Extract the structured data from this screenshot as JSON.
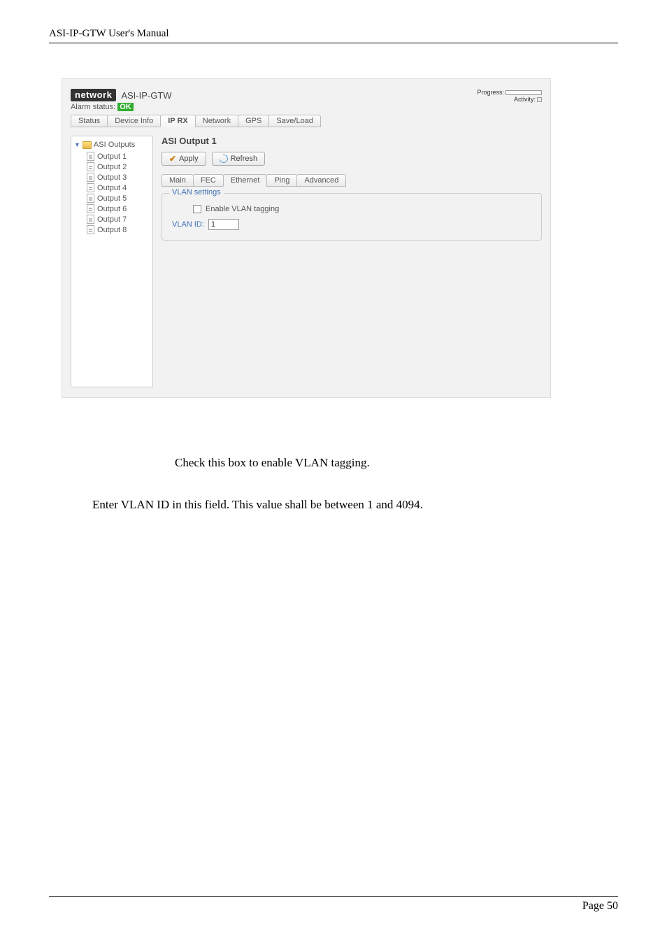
{
  "doc": {
    "header": "ASI-IP-GTW User's Manual",
    "footer_label": "Page",
    "footer_page": "50",
    "para1": "Check this box to enable VLAN tagging.",
    "para2": "Enter VLAN ID in this field. This value shall be between 1 and 4094."
  },
  "ui": {
    "logo": "network",
    "device": "ASI-IP-GTW",
    "progress_label": "Progress:",
    "activity_label": "Activity:",
    "alarm_label": "Alarm status:",
    "alarm_value": "OK",
    "tabs": [
      "Status",
      "Device Info",
      "IP RX",
      "Network",
      "GPS",
      "Save/Load"
    ],
    "active_tab": 2,
    "sidebar": {
      "root": "ASI Outputs",
      "items": [
        "Output 1",
        "Output 2",
        "Output 3",
        "Output 4",
        "Output 5",
        "Output 6",
        "Output 7",
        "Output 8"
      ]
    },
    "pane_title": "ASI Output 1",
    "apply_label": "Apply",
    "refresh_label": "Refresh",
    "subtabs": [
      "Main",
      "FEC",
      "Ethernet",
      "Ping",
      "Advanced"
    ],
    "active_subtab": 2,
    "fieldset_legend": "VLAN settings",
    "enable_label": "Enable VLAN tagging",
    "vlan_id_label": "VLAN ID:",
    "vlan_id_value": "1"
  }
}
